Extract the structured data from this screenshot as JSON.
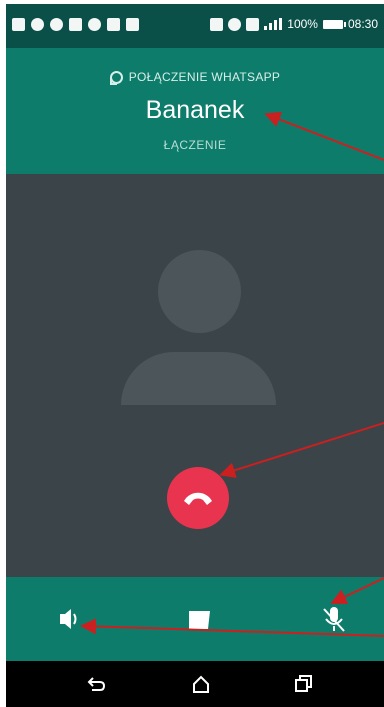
{
  "status_bar": {
    "battery": "100%",
    "time": "08:30",
    "icons": [
      "message-icon",
      "app-icon",
      "app-icon",
      "flipboard-icon",
      "phone-icon",
      "device-icon",
      "calendar-icon",
      "nfc-icon",
      "alarm-icon",
      "wifi-icon",
      "signal-icon",
      "battery-icon"
    ]
  },
  "call": {
    "label": "POŁĄCZENIE WHATSAPP",
    "contact": "Bananek",
    "status": "ŁĄCZENIE"
  },
  "controls": {
    "items": [
      "speaker-icon",
      "message-icon",
      "mute-microphone-icon"
    ]
  },
  "navigation": {
    "items": [
      "back-icon",
      "home-icon",
      "recent-apps-icon"
    ]
  },
  "colors": {
    "header": "#0e7c6b",
    "status_bar": "#0b5048",
    "body": "#3b4448",
    "avatar": "#4c565a",
    "end_call": "#e8344e",
    "annotation": "#cc1f1f"
  }
}
